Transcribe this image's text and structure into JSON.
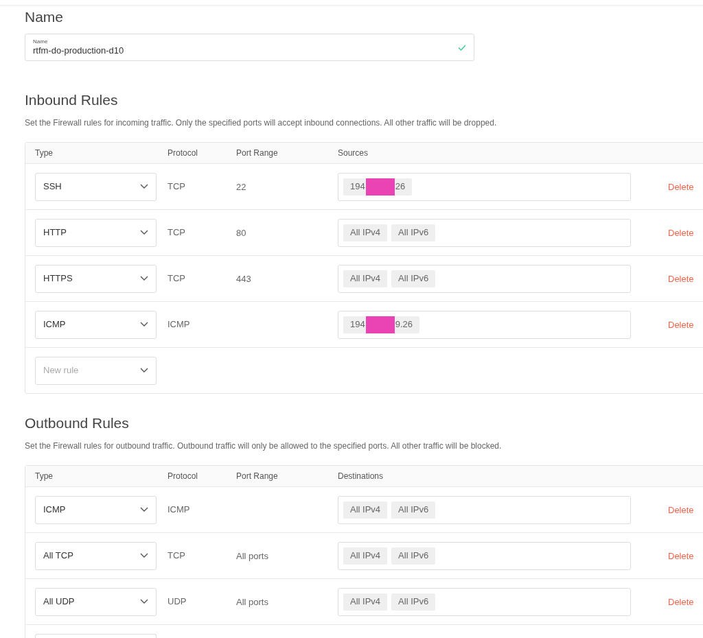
{
  "name_section": {
    "heading": "Name",
    "field_label": "Name",
    "value": "rtfm-do-production-d10",
    "valid": true
  },
  "inbound": {
    "heading": "Inbound Rules",
    "description": "Set the Firewall rules for incoming traffic. Only the specified ports will accept inbound connections. All other traffic will be dropped.",
    "columns": [
      "Type",
      "Protocol",
      "Port Range",
      "Sources"
    ],
    "rows": [
      {
        "kind": "rule",
        "type": "SSH",
        "protocol": "TCP",
        "port_range": "22",
        "tags": [
          {
            "before": "194",
            "after": "26",
            "redacted": true
          }
        ],
        "action": "Delete"
      },
      {
        "kind": "rule",
        "type": "HTTP",
        "protocol": "TCP",
        "port_range": "80",
        "tags": [
          {
            "before": "All IPv4",
            "redacted": false
          },
          {
            "before": "All IPv6",
            "redacted": false
          }
        ],
        "action": "Delete"
      },
      {
        "kind": "rule",
        "type": "HTTPS",
        "protocol": "TCP",
        "port_range": "443",
        "tags": [
          {
            "before": "All IPv4",
            "redacted": false
          },
          {
            "before": "All IPv6",
            "redacted": false
          }
        ],
        "action": "Delete"
      },
      {
        "kind": "rule",
        "type": "ICMP",
        "protocol": "ICMP",
        "tags": [
          {
            "before": "194",
            "after": "9.26",
            "redacted": true
          }
        ],
        "action": "Delete"
      },
      {
        "kind": "new",
        "placeholder": "New rule"
      }
    ]
  },
  "outbound": {
    "heading": "Outbound Rules",
    "description": "Set the Firewall rules for outbound traffic. Outbound traffic will only be allowed to the specified ports. All other traffic will be blocked.",
    "columns": [
      "Type",
      "Protocol",
      "Port Range",
      "Destinations"
    ],
    "rows": [
      {
        "kind": "rule",
        "type": "ICMP",
        "protocol": "ICMP",
        "tags": [
          {
            "before": "All IPv4",
            "redacted": false
          },
          {
            "before": "All IPv6",
            "redacted": false
          }
        ],
        "action": "Delete"
      },
      {
        "kind": "rule",
        "type": "All TCP",
        "protocol": "TCP",
        "port_range": "All ports",
        "tags": [
          {
            "before": "All IPv4",
            "redacted": false
          },
          {
            "before": "All IPv6",
            "redacted": false
          }
        ],
        "action": "Delete"
      },
      {
        "kind": "rule",
        "type": "All UDP",
        "protocol": "UDP",
        "port_range": "All ports",
        "tags": [
          {
            "before": "All IPv4",
            "redacted": false
          },
          {
            "before": "All IPv6",
            "redacted": false
          }
        ],
        "action": "Delete"
      },
      {
        "kind": "cut"
      }
    ]
  }
}
